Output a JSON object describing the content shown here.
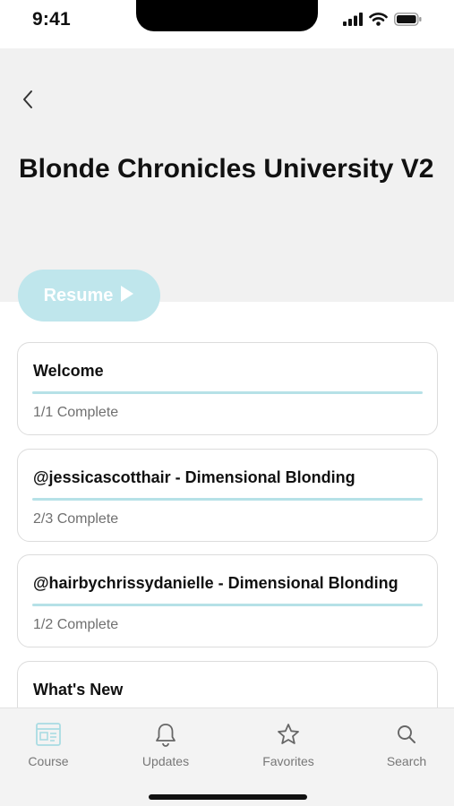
{
  "status": {
    "time": "9:41"
  },
  "header": {
    "title": "Blonde Chronicles University V2",
    "back_icon": "chevron-left-icon"
  },
  "resume": {
    "label": "Resume",
    "icon": "play-icon",
    "color": "#bfe6ec"
  },
  "sections": [
    {
      "title": "Welcome",
      "status": "1/1 Complete",
      "progress": 1.0
    },
    {
      "title": "@jessicascotthair - Dimensional Blonding",
      "status": "2/3 Complete",
      "progress": 1.0
    },
    {
      "title": "@hairbychrissydanielle - Dimensional Blonding",
      "status": "1/2 Complete",
      "progress": 1.0
    },
    {
      "title": "What's New"
    }
  ],
  "tabs": [
    {
      "label": "Course",
      "icon": "course-icon",
      "active": true
    },
    {
      "label": "Updates",
      "icon": "bell-icon"
    },
    {
      "label": "Favorites",
      "icon": "star-icon"
    },
    {
      "label": "Search",
      "icon": "search-icon"
    }
  ],
  "colors": {
    "accent": "#b6e1e7",
    "header_bg": "#f1f1f1",
    "tab_bar_bg": "#f3f3f3"
  }
}
